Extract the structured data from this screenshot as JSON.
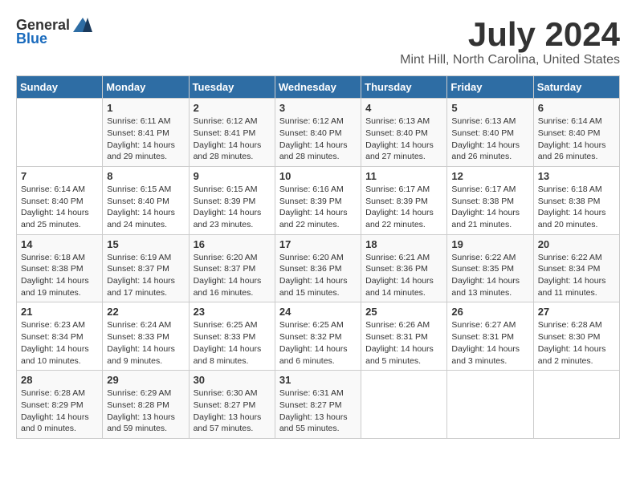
{
  "header": {
    "logo_general": "General",
    "logo_blue": "Blue",
    "month_year": "July 2024",
    "location": "Mint Hill, North Carolina, United States"
  },
  "calendar": {
    "days_of_week": [
      "Sunday",
      "Monday",
      "Tuesday",
      "Wednesday",
      "Thursday",
      "Friday",
      "Saturday"
    ],
    "weeks": [
      [
        {
          "day": "",
          "info": ""
        },
        {
          "day": "1",
          "info": "Sunrise: 6:11 AM\nSunset: 8:41 PM\nDaylight: 14 hours\nand 29 minutes."
        },
        {
          "day": "2",
          "info": "Sunrise: 6:12 AM\nSunset: 8:41 PM\nDaylight: 14 hours\nand 28 minutes."
        },
        {
          "day": "3",
          "info": "Sunrise: 6:12 AM\nSunset: 8:40 PM\nDaylight: 14 hours\nand 28 minutes."
        },
        {
          "day": "4",
          "info": "Sunrise: 6:13 AM\nSunset: 8:40 PM\nDaylight: 14 hours\nand 27 minutes."
        },
        {
          "day": "5",
          "info": "Sunrise: 6:13 AM\nSunset: 8:40 PM\nDaylight: 14 hours\nand 26 minutes."
        },
        {
          "day": "6",
          "info": "Sunrise: 6:14 AM\nSunset: 8:40 PM\nDaylight: 14 hours\nand 26 minutes."
        }
      ],
      [
        {
          "day": "7",
          "info": "Sunrise: 6:14 AM\nSunset: 8:40 PM\nDaylight: 14 hours\nand 25 minutes."
        },
        {
          "day": "8",
          "info": "Sunrise: 6:15 AM\nSunset: 8:40 PM\nDaylight: 14 hours\nand 24 minutes."
        },
        {
          "day": "9",
          "info": "Sunrise: 6:15 AM\nSunset: 8:39 PM\nDaylight: 14 hours\nand 23 minutes."
        },
        {
          "day": "10",
          "info": "Sunrise: 6:16 AM\nSunset: 8:39 PM\nDaylight: 14 hours\nand 22 minutes."
        },
        {
          "day": "11",
          "info": "Sunrise: 6:17 AM\nSunset: 8:39 PM\nDaylight: 14 hours\nand 22 minutes."
        },
        {
          "day": "12",
          "info": "Sunrise: 6:17 AM\nSunset: 8:38 PM\nDaylight: 14 hours\nand 21 minutes."
        },
        {
          "day": "13",
          "info": "Sunrise: 6:18 AM\nSunset: 8:38 PM\nDaylight: 14 hours\nand 20 minutes."
        }
      ],
      [
        {
          "day": "14",
          "info": "Sunrise: 6:18 AM\nSunset: 8:38 PM\nDaylight: 14 hours\nand 19 minutes."
        },
        {
          "day": "15",
          "info": "Sunrise: 6:19 AM\nSunset: 8:37 PM\nDaylight: 14 hours\nand 17 minutes."
        },
        {
          "day": "16",
          "info": "Sunrise: 6:20 AM\nSunset: 8:37 PM\nDaylight: 14 hours\nand 16 minutes."
        },
        {
          "day": "17",
          "info": "Sunrise: 6:20 AM\nSunset: 8:36 PM\nDaylight: 14 hours\nand 15 minutes."
        },
        {
          "day": "18",
          "info": "Sunrise: 6:21 AM\nSunset: 8:36 PM\nDaylight: 14 hours\nand 14 minutes."
        },
        {
          "day": "19",
          "info": "Sunrise: 6:22 AM\nSunset: 8:35 PM\nDaylight: 14 hours\nand 13 minutes."
        },
        {
          "day": "20",
          "info": "Sunrise: 6:22 AM\nSunset: 8:34 PM\nDaylight: 14 hours\nand 11 minutes."
        }
      ],
      [
        {
          "day": "21",
          "info": "Sunrise: 6:23 AM\nSunset: 8:34 PM\nDaylight: 14 hours\nand 10 minutes."
        },
        {
          "day": "22",
          "info": "Sunrise: 6:24 AM\nSunset: 8:33 PM\nDaylight: 14 hours\nand 9 minutes."
        },
        {
          "day": "23",
          "info": "Sunrise: 6:25 AM\nSunset: 8:33 PM\nDaylight: 14 hours\nand 8 minutes."
        },
        {
          "day": "24",
          "info": "Sunrise: 6:25 AM\nSunset: 8:32 PM\nDaylight: 14 hours\nand 6 minutes."
        },
        {
          "day": "25",
          "info": "Sunrise: 6:26 AM\nSunset: 8:31 PM\nDaylight: 14 hours\nand 5 minutes."
        },
        {
          "day": "26",
          "info": "Sunrise: 6:27 AM\nSunset: 8:31 PM\nDaylight: 14 hours\nand 3 minutes."
        },
        {
          "day": "27",
          "info": "Sunrise: 6:28 AM\nSunset: 8:30 PM\nDaylight: 14 hours\nand 2 minutes."
        }
      ],
      [
        {
          "day": "28",
          "info": "Sunrise: 6:28 AM\nSunset: 8:29 PM\nDaylight: 14 hours\nand 0 minutes."
        },
        {
          "day": "29",
          "info": "Sunrise: 6:29 AM\nSunset: 8:28 PM\nDaylight: 13 hours\nand 59 minutes."
        },
        {
          "day": "30",
          "info": "Sunrise: 6:30 AM\nSunset: 8:27 PM\nDaylight: 13 hours\nand 57 minutes."
        },
        {
          "day": "31",
          "info": "Sunrise: 6:31 AM\nSunset: 8:27 PM\nDaylight: 13 hours\nand 55 minutes."
        },
        {
          "day": "",
          "info": ""
        },
        {
          "day": "",
          "info": ""
        },
        {
          "day": "",
          "info": ""
        }
      ]
    ]
  }
}
